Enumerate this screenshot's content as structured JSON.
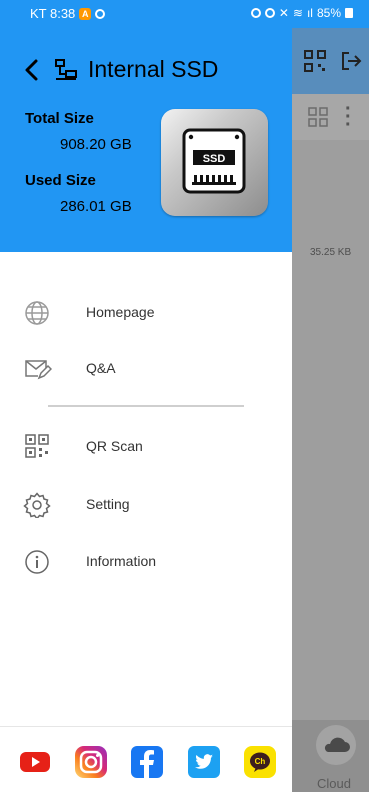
{
  "status_bar": {
    "carrier_time": "KT 8:38",
    "alert_badge": "A",
    "battery": "85%"
  },
  "drawer": {
    "title": "Internal SSD",
    "total_size_label": "Total Size",
    "total_size_value": "908.20 GB",
    "used_size_label": "Used Size",
    "used_size_value": "286.01 GB",
    "ssd_chip_text": "SSD",
    "menu": [
      {
        "label": "Homepage",
        "icon": "globe-icon"
      },
      {
        "label": "Q&A",
        "icon": "mail-edit-icon"
      },
      {
        "label": "QR Scan",
        "icon": "qr-code-icon"
      },
      {
        "label": "Setting",
        "icon": "gear-icon"
      },
      {
        "label": "Information",
        "icon": "info-icon"
      }
    ],
    "social": [
      {
        "name": "youtube",
        "icon": "youtube-icon",
        "color": "#E62117"
      },
      {
        "name": "instagram",
        "icon": "instagram-icon",
        "color": "#D6249F"
      },
      {
        "name": "facebook",
        "icon": "facebook-icon",
        "color": "#1877F2"
      },
      {
        "name": "twitter",
        "icon": "twitter-icon",
        "color": "#1DA1F2"
      },
      {
        "name": "kakao-channel",
        "icon": "kakao-channel-icon",
        "color": "#FAE100",
        "text": "Ch"
      }
    ]
  },
  "background_app": {
    "file_size": "35.25 KB",
    "cloud_label": "Cloud"
  },
  "colors": {
    "accent": "#2196F3",
    "scrim": "#9e9e9e"
  }
}
